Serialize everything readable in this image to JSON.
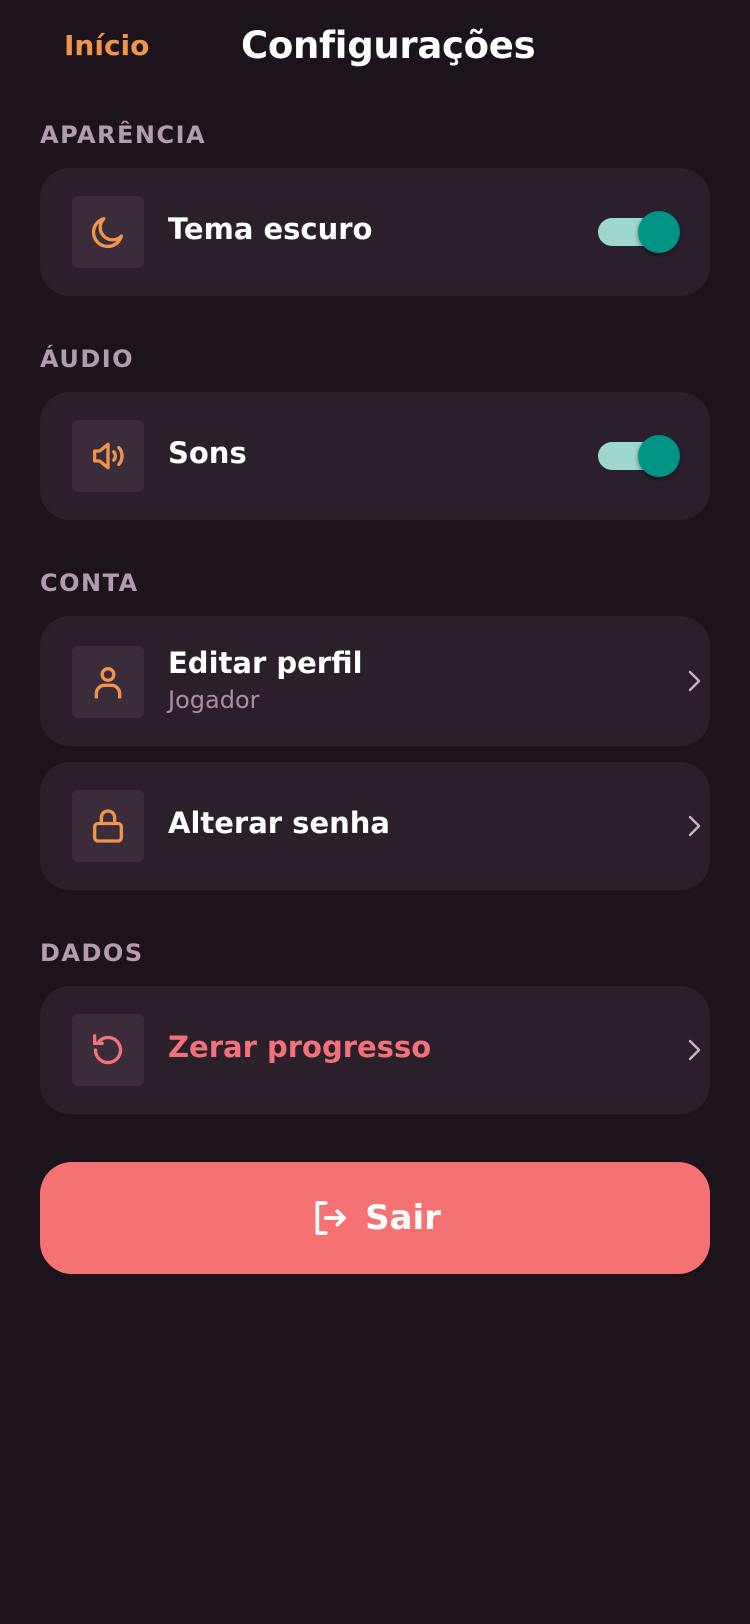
{
  "header": {
    "back_label": "Início",
    "title": "Configurações"
  },
  "sections": {
    "appearance": {
      "label": "APARÊNCIA",
      "dark_theme": {
        "label": "Tema escuro",
        "icon": "moon-icon",
        "enabled": true
      }
    },
    "audio": {
      "label": "ÁUDIO",
      "sounds": {
        "label": "Sons",
        "icon": "speaker-icon",
        "enabled": true
      }
    },
    "account": {
      "label": "CONTA",
      "edit_profile": {
        "label": "Editar perfil",
        "subtitle": "Jogador",
        "icon": "user-icon"
      },
      "change_password": {
        "label": "Alterar senha",
        "icon": "lock-icon"
      }
    },
    "data": {
      "label": "DADOS",
      "reset_progress": {
        "label": "Zerar progresso",
        "icon": "reset-icon"
      }
    }
  },
  "logout": {
    "label": "Sair",
    "icon": "logout-icon"
  },
  "colors": {
    "background": "#1d131d",
    "card": "#2b1f2c",
    "accent_orange": "#f0944a",
    "danger": "#f2717a",
    "toggle_on": "#009485",
    "logout_button": "#f67272"
  }
}
